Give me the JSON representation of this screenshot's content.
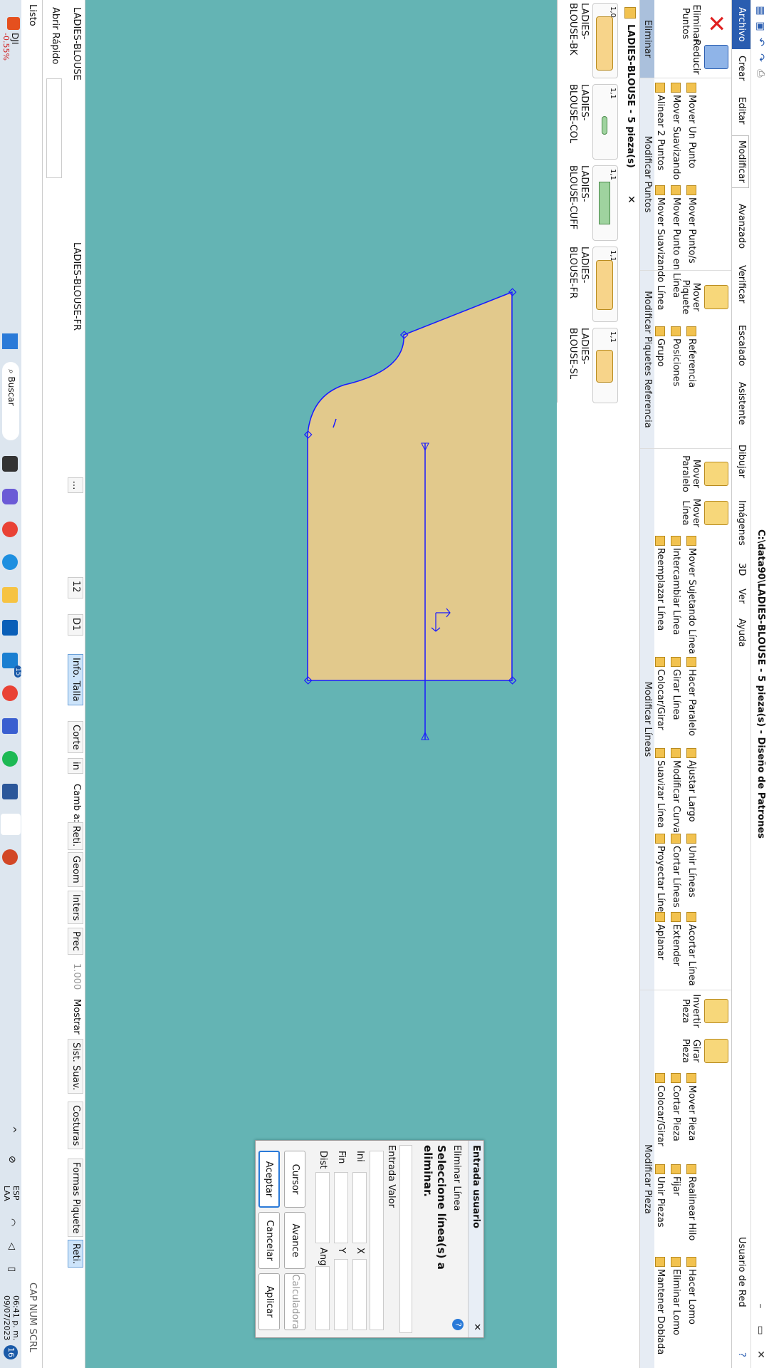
{
  "window": {
    "title": "C:\\data90\\LADIES-BLOUSE  -  5 pieza(s) - Diseño de Patrones",
    "user": "Usuario de Red"
  },
  "menu": [
    "Archivo",
    "Crear",
    "Editar",
    "Modificar",
    "Avanzado",
    "Verificar",
    "Escalado",
    "Asistente",
    "Dibujar",
    "Imágenes",
    "3D",
    "Ver",
    "Ayuda"
  ],
  "ribbon": {
    "eliminar": {
      "btn1": "Eliminar Puntos",
      "btn2": "Reducir",
      "label": "Eliminar"
    },
    "puntos": {
      "items": [
        "Mover Un Punto",
        "Mover Punto/s",
        "Mover Suavizando",
        "Mover Punto en Línea",
        "Alinear 2 Puntos",
        "Mover Suavizando Línea"
      ],
      "label": "Modificar Puntos"
    },
    "piquetes": {
      "big": "Mover Piquete",
      "items": [
        "Referencia",
        "Posiciones",
        "Grupo"
      ],
      "label": "Modificar Piquetes Referencia"
    },
    "lineas": {
      "big1": "Mover Paralelo",
      "big2": "Mover Línea",
      "items": [
        "Mover Sujetando Línea",
        "Intercambiar Línea",
        "Reemplazar Línea",
        "Hacer Paralelo",
        "Girar Línea",
        "Colocar/Girar",
        "Ajustar Largo",
        "Modificar Curva",
        "Suavizar Línea",
        "Unir Líneas",
        "Cortar Líneas",
        "Proyectar Línea",
        "Acortar Línea",
        "Extender",
        "Aplanar"
      ],
      "label": "Modificar Líneas"
    },
    "pieza": {
      "big1": "Invertir Pieza",
      "big2": "Girar Pieza",
      "items": [
        "Mover Pieza",
        "Cortar Pieza",
        "Colocar/Girar",
        "Realinear Hilo",
        "Fijar",
        "Unir Piezas",
        "Hacer Lomo",
        "Eliminar Lomo",
        "Mantener Doblada"
      ],
      "label": "Modificar Pieza"
    }
  },
  "doc_tab": {
    "label": "LADIES-BLOUSE  -  5 pieza(s)",
    "close": "✕"
  },
  "thumbnails": [
    {
      "qty": "1,0",
      "name": "LADIES-BLOUSE-BK"
    },
    {
      "qty": "1,1",
      "name": "LADIES-BLOUSE-COL"
    },
    {
      "qty": "1,1",
      "name": "LADIES-BLOUSE-CUFF"
    },
    {
      "qty": "1,1",
      "name": "LADIES-BLOUSE-FR"
    },
    {
      "qty": "1,1",
      "name": "LADIES-BLOUSE-SL"
    }
  ],
  "dialog": {
    "title": "Entrada usuario",
    "mode": "Eliminar Línea",
    "prompt": "Seleccione línea(s) a eliminar.",
    "entrada": "Entrada Valor",
    "fields": {
      "ini": "Ini",
      "fin": "Fin",
      "dist": "Dist",
      "x": "X",
      "y": "Y",
      "ang": "Ang"
    },
    "buttons": {
      "cursor": "Cursor",
      "avance": "Avance",
      "calculadora": "Calculadora",
      "aceptar": "Aceptar",
      "cancelar": "Cancelar",
      "aplicar": "Aplicar"
    }
  },
  "bottom": {
    "style": "LADIES-BLOUSE",
    "piece": "LADIES-BLOUSE-FR",
    "size": "12",
    "d": "D1",
    "buttons": [
      "Info. Talla",
      "Corte",
      "in",
      "Camb a:",
      "Reti.",
      "Geom",
      "Inters",
      "Prec",
      "1.000",
      "Mostrar",
      "Sist. Suav.",
      "Costuras",
      "Formas Piquete",
      "Reti."
    ],
    "abrir_rapido": "Abrir Rápido",
    "status": "Listo",
    "indicators": "CAP  NUM  SCRL"
  },
  "taskbar": {
    "ticker": "DJI",
    "ticker_change": "-0.55%",
    "search": "Buscar",
    "lang1": "ESP",
    "lang2": "LAA",
    "time": "06:41 p. m.",
    "date": "09/07/2023",
    "badge": "16",
    "app_badge": "15"
  },
  "colors": {
    "canvas": "#64b4b4",
    "piece_fill": "#e2c98c",
    "outline": "#1a1aff",
    "accent": "#2a5db0"
  }
}
